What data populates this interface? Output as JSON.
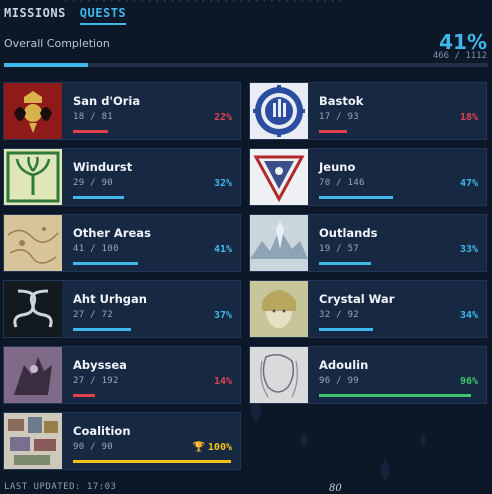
{
  "tabs": [
    {
      "label": "MISSIONS",
      "active": false
    },
    {
      "label": "QUESTS",
      "active": true
    }
  ],
  "overall": {
    "label": "Overall Completion",
    "percent": "41%",
    "count": "466 / 1112",
    "fraction": 0.41
  },
  "cards": [
    {
      "name": "San d'Oria",
      "count": "18 / 81",
      "percent": "22%",
      "fraction": 0.22,
      "status": "low",
      "icon": "san-doria-crest"
    },
    {
      "name": "Bastok",
      "count": "17 / 93",
      "percent": "18%",
      "fraction": 0.18,
      "status": "low",
      "icon": "bastok-gear-emblem"
    },
    {
      "name": "Windurst",
      "count": "29 / 90",
      "percent": "32%",
      "fraction": 0.32,
      "status": "mid",
      "icon": "windurst-tree-emblem"
    },
    {
      "name": "Jeuno",
      "count": "70 / 146",
      "percent": "47%",
      "fraction": 0.47,
      "status": "mid",
      "icon": "jeuno-triangle-emblem"
    },
    {
      "name": "Other Areas",
      "count": "41 / 100",
      "percent": "41%",
      "fraction": 0.41,
      "status": "mid",
      "icon": "old-map-art"
    },
    {
      "name": "Outlands",
      "count": "19 / 57",
      "percent": "33%",
      "fraction": 0.33,
      "status": "mid",
      "icon": "outlands-landscape-art"
    },
    {
      "name": "Aht Urhgan",
      "count": "27 / 72",
      "percent": "37%",
      "fraction": 0.37,
      "status": "mid",
      "icon": "aht-urhgan-serpent-emblem"
    },
    {
      "name": "Crystal War",
      "count": "32 / 92",
      "percent": "34%",
      "fraction": 0.34,
      "status": "mid",
      "icon": "crystal-war-portrait-art"
    },
    {
      "name": "Abyssea",
      "count": "27 / 192",
      "percent": "14%",
      "fraction": 0.14,
      "status": "low",
      "icon": "abyssea-creature-art"
    },
    {
      "name": "Adoulin",
      "count": "96 / 99",
      "percent": "96%",
      "fraction": 0.96,
      "status": "high",
      "icon": "adoulin-sketch-art"
    },
    {
      "name": "Coalition",
      "count": "90 / 90",
      "percent": "100%",
      "fraction": 1.0,
      "status": "complete",
      "icon": "coalition-collage-art"
    }
  ],
  "colors": {
    "low": "#e0434c",
    "mid": "#3fb8ea",
    "high": "#3ec46a",
    "complete": "#f0c419"
  },
  "footer": {
    "last_updated": "LAST UPDATED: 17:03",
    "page_number": "80"
  }
}
